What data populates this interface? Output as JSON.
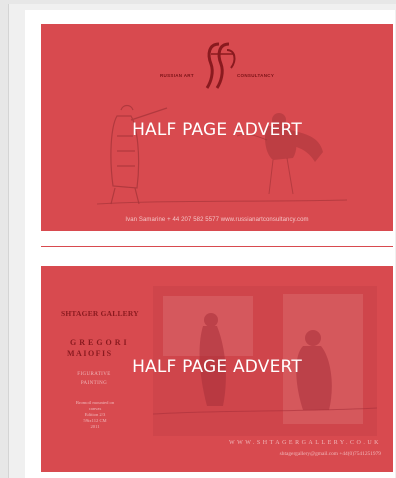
{
  "adverts": [
    {
      "label": "HALF PAGE ADVERT",
      "logo": {
        "left": "RUSSIAN ART",
        "right": "CONSULTANCY"
      },
      "contact": "Ivan Samarine   + 44 207 582 5577  www.russianartconsultancy.com"
    },
    {
      "label": "HALF PAGE ADVERT",
      "gallery": "SHTAGER GALLERY",
      "artist_first": "GREGORI",
      "artist_last": "MAIOFIS",
      "genre": "FIGURATIVE PAINTING",
      "details": [
        "Bromoil mounted on",
        "canvas",
        "Edition 2/3",
        "59ix112 CM",
        "2011"
      ],
      "web": "WWW.SHTAGERGALLERY.CO.UK",
      "email": "shtagergallery@gmail.com   +44(0)7541251979"
    }
  ],
  "colors": {
    "advert_fill": "#d84a4f",
    "divider": "#d84a4f",
    "label": "#ffffff"
  }
}
